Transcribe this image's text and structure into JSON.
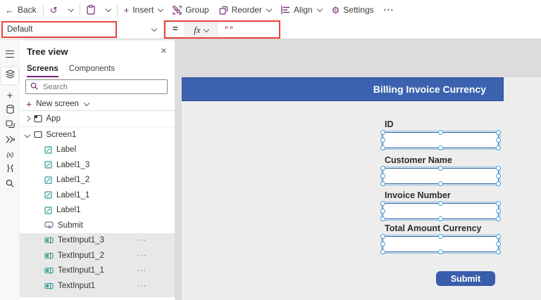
{
  "command_bar": {
    "back": "Back",
    "insert": "Insert",
    "group": "Group",
    "reorder": "Reorder",
    "align": "Align",
    "settings": "Settings"
  },
  "icons": {
    "back_arrow": "←",
    "undo": "↺",
    "gear": "⚙",
    "overflow": "···",
    "plus": "+",
    "close": "✕",
    "ellipsis": "···",
    "variables": "(x)"
  },
  "formula_bar": {
    "property": "Default",
    "equals": "=",
    "fx_label": "fx",
    "value": "\"\""
  },
  "tree_panel": {
    "title": "Tree view",
    "tabs": [
      {
        "label": "Screens",
        "active": true
      },
      {
        "label": "Components",
        "active": false
      }
    ],
    "search_placeholder": "Search",
    "new_screen_label": "New screen",
    "app_label": "App",
    "screen_label": "Screen1",
    "items": [
      {
        "label": "Label",
        "icon": "label-control-icon",
        "selected": false
      },
      {
        "label": "Label1_3",
        "icon": "label-control-icon",
        "selected": false
      },
      {
        "label": "Label1_2",
        "icon": "label-control-icon",
        "selected": false
      },
      {
        "label": "Label1_1",
        "icon": "label-control-icon",
        "selected": false
      },
      {
        "label": "Label1",
        "icon": "label-control-icon",
        "selected": false
      },
      {
        "label": "Submit",
        "icon": "button-control-icon",
        "selected": false
      },
      {
        "label": "TextInput1_3",
        "icon": "text-input-control-icon",
        "selected": true
      },
      {
        "label": "TextInput1_2",
        "icon": "text-input-control-icon",
        "selected": true
      },
      {
        "label": "TextInput1_1",
        "icon": "text-input-control-icon",
        "selected": true
      },
      {
        "label": "TextInput1",
        "icon": "text-input-control-icon",
        "selected": true
      }
    ]
  },
  "canvas": {
    "header_title": "Billing Invoice Currency",
    "fields": [
      {
        "label": "ID"
      },
      {
        "label": "Customer Name"
      },
      {
        "label": "Invoice Number"
      },
      {
        "label": "Total Amount Currency"
      }
    ],
    "submit_label": "Submit"
  },
  "colors": {
    "header_blue": "#3b62ae",
    "submit_blue": "#3a5dab",
    "highlight_red": "#e8443a",
    "accent_purple": "#742774",
    "formula_string_red": "#a81c1c",
    "input_border_blue": "#2b5c9c",
    "selection_handle_blue": "#4ba0dc",
    "tree_selected_gray": "#e8e8e8",
    "studio_background": "#dcdcdc",
    "screen_background": "#ededed"
  }
}
